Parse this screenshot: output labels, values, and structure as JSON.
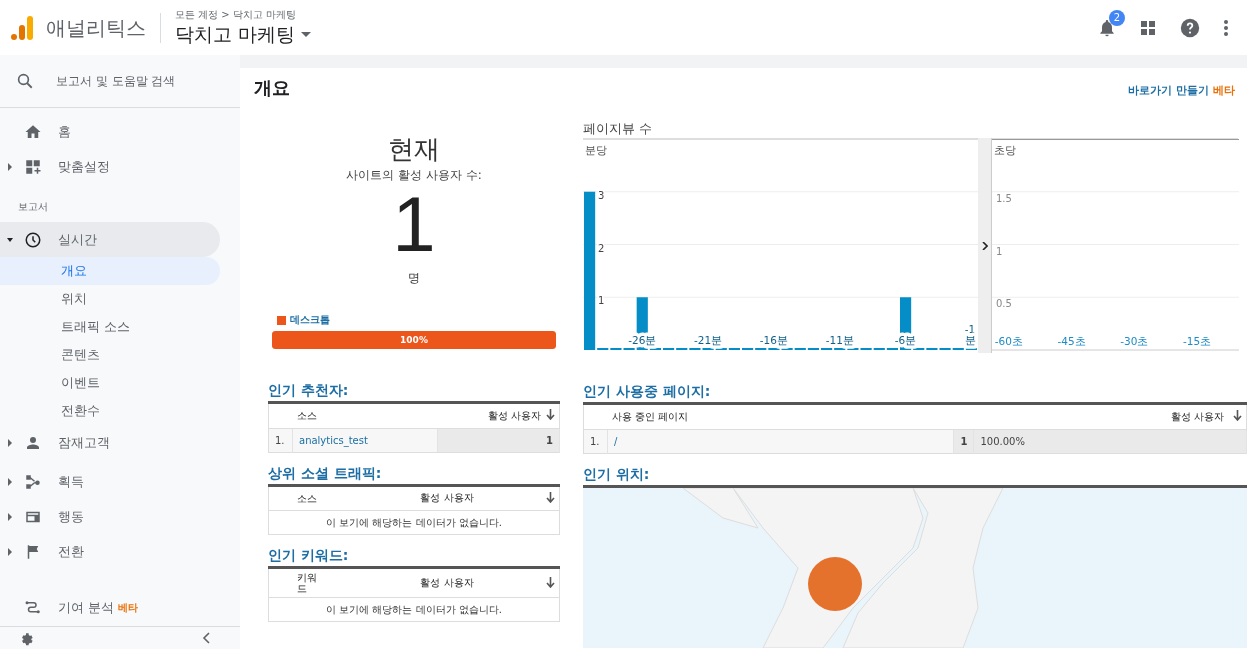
{
  "header": {
    "app_name": "애널리틱스",
    "breadcrumb": "모든 계정 > 닥치고 마케팅",
    "property": "닥치고 마케팅",
    "notification_count": "2"
  },
  "sidebar": {
    "search_placeholder": "보고서 및 도움말 검색",
    "section_label": "보고서",
    "items": [
      {
        "label": "홈",
        "expandable": false,
        "expanded": false,
        "selected": false
      },
      {
        "label": "맞춤설정",
        "expandable": true,
        "expanded": false,
        "selected": false
      },
      {
        "label": "실시간",
        "expandable": true,
        "expanded": true,
        "selected": true,
        "children": [
          {
            "label": "개요",
            "selected": true
          },
          {
            "label": "위치",
            "selected": false
          },
          {
            "label": "트래픽 소스",
            "selected": false
          },
          {
            "label": "콘텐츠",
            "selected": false
          },
          {
            "label": "이벤트",
            "selected": false
          },
          {
            "label": "전환수",
            "selected": false
          }
        ]
      },
      {
        "label": "잠재고객",
        "expandable": true,
        "expanded": false,
        "selected": false
      },
      {
        "label": "획득",
        "expandable": true,
        "expanded": false,
        "selected": false
      },
      {
        "label": "행동",
        "expandable": true,
        "expanded": false,
        "selected": false
      },
      {
        "label": "전환",
        "expandable": true,
        "expanded": false,
        "selected": false
      }
    ],
    "attribution": {
      "label": "기여 분석",
      "badge": "베타"
    }
  },
  "page": {
    "title": "개요",
    "shortcut": "바로가기 만들기",
    "shortcut_badge": "베타"
  },
  "now": {
    "heading": "현재",
    "subtitle": "사이트의 활성 사용자 수:",
    "count": "1",
    "unit": "명",
    "device": "데스크톱",
    "level": 1,
    "reading": "100%"
  },
  "pageviews": {
    "title": "페이지뷰 수",
    "per_minute": {
      "chart_data": {
        "type": "bar",
        "grid": true,
        "xlim": [
          -30.5,
          -0.5
        ],
        "ylim": [
          0,
          4
        ],
        "x": [
          -30,
          -29,
          -28,
          -27,
          -26,
          -25,
          -24,
          -23,
          -22,
          -21,
          -20,
          -19,
          -18,
          -17,
          -16,
          -15,
          -14,
          -13,
          -12,
          -11,
          -10,
          -9,
          -8,
          -7,
          -6,
          -5,
          -4,
          -3,
          -2,
          -1
        ],
        "series": [
          {
            "name": "분당",
            "color": "#058dc7",
            "values": [
              3,
              0,
              0,
              0,
              1,
              0,
              0,
              0,
              0,
              0,
              0,
              0,
              0,
              0,
              0,
              0,
              0,
              0,
              0,
              0,
              0,
              0,
              0,
              0,
              1,
              0,
              0,
              0,
              0,
              0
            ]
          }
        ],
        "xticks": [
          {
            "value": -26,
            "label": "-26분"
          },
          {
            "value": -21,
            "label": "-21분"
          },
          {
            "value": -16,
            "label": "-16분"
          },
          {
            "value": -11,
            "label": "-11분"
          },
          {
            "value": -6,
            "label": "-6분"
          },
          {
            "value": -1,
            "label": "-1\n분"
          }
        ],
        "yticks": [
          1,
          2,
          3
        ]
      }
    },
    "per_second": {
      "label": "초당",
      "chart_data": {
        "type": "bar",
        "grid": true,
        "xlim": [
          -64,
          -5
        ],
        "ylim": [
          0,
          2
        ],
        "yticks": [
          0.5,
          1,
          1.5
        ],
        "xticks": [
          {
            "value": -60,
            "label": "-60초"
          },
          {
            "value": -45,
            "label": "-45초"
          },
          {
            "value": -30,
            "label": "-30초"
          },
          {
            "value": -15,
            "label": "-15초"
          }
        ]
      }
    }
  },
  "referrers": {
    "title": "인기 추천자:",
    "columns": [
      "소스",
      "활성 사용자"
    ],
    "rows": [
      {
        "rank": "1.",
        "source": "analytics_test",
        "users": "1"
      }
    ]
  },
  "social": {
    "title": "상위 소셜 트래픽:",
    "columns": [
      "소스",
      "활성 사용자"
    ],
    "empty": "이 보기에 해당하는 데이터가 없습니다."
  },
  "keywords": {
    "title": "인기 키워드:",
    "columns": [
      "키워\n드",
      "활성 사용자"
    ],
    "empty": "이 보기에 해당하는 데이터가 없습니다."
  },
  "pages": {
    "title": "인기 사용중 페이지:",
    "columns": [
      "사용 중인 페이지",
      "활성 사용자"
    ],
    "rows": [
      {
        "rank": "1.",
        "page": "/",
        "users": "1",
        "share": "100.00%"
      }
    ]
  },
  "locations": {
    "title": "인기 위치:"
  }
}
